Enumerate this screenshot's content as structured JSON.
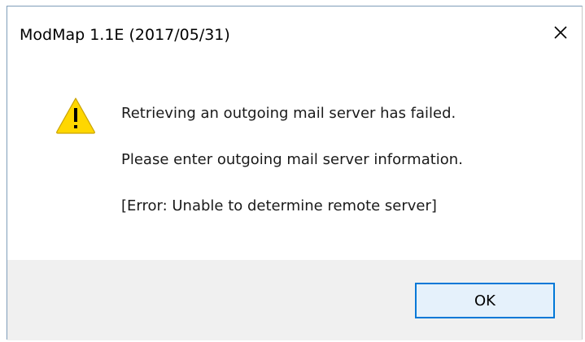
{
  "window": {
    "title": "ModMap 1.1E (2017/05/31)",
    "close_icon": "close-icon"
  },
  "message": {
    "icon": "warning-icon",
    "lines": [
      "Retrieving an outgoing mail server has failed.",
      "Please enter outgoing mail server information.",
      "[Error: Unable to determine remote server]"
    ]
  },
  "buttons": {
    "ok_label": "OK"
  },
  "colors": {
    "accent": "#0078d7",
    "warning_fill": "#ffd700",
    "footer_bg": "#f0f0f0"
  }
}
